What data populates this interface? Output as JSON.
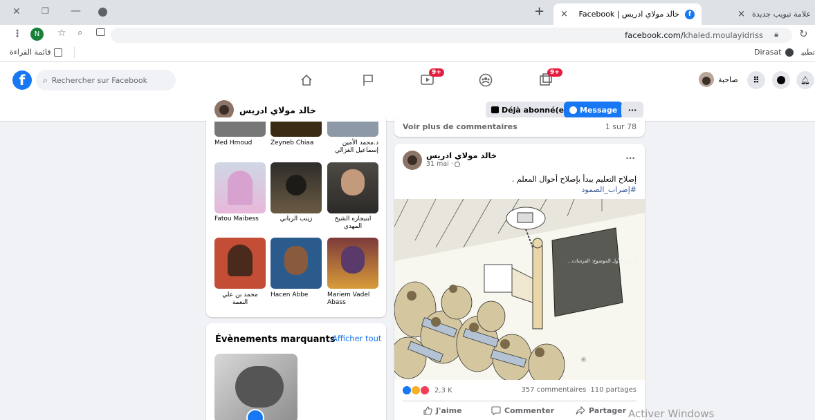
{
  "browser": {
    "tabs": [
      {
        "label": "خالد مولاي ادريس | Facebook",
        "close": "×"
      },
      {
        "label": "علامة تبويب جديدة",
        "close": "×"
      }
    ],
    "new_tab": "+",
    "url_host": "facebook.com/",
    "url_path": "khaled.moulayidriss",
    "profile_initial": "N",
    "bookmarks": {
      "reading_list": "قائمة القراءة",
      "dirasat": "Dirasat",
      "apps": "تطبيقات"
    }
  },
  "facebook": {
    "search_placeholder": "Rechercher sur Facebook",
    "video_badge": "9+",
    "notif_badge": "9+",
    "user_name": "صاحبة",
    "profile": {
      "name": "خالد مولاي ادريس",
      "subscribed": "Déjà abonné(e)",
      "message": "Message",
      "more": "···"
    },
    "friends": [
      {
        "name": "Med Hmoud"
      },
      {
        "name": "Zeyneb Chiaa"
      },
      {
        "name": "د.محمد الأمين إسماعيل الغزالي"
      },
      {
        "name": "Fatou Maibess"
      },
      {
        "name": "زينب الرباني"
      },
      {
        "name": "ابنيجاره الشيخ المهدي"
      },
      {
        "name": "محمد بن علي النعمة"
      },
      {
        "name": "Hacen Abbe"
      },
      {
        "name": "Mariem Vadel Abass"
      }
    ],
    "highlights": {
      "title": "Évènements marquants",
      "see_all": "Afficher tout"
    },
    "prev_post": {
      "more_comments": "Voir plus de commentaires",
      "count": "1 sur 78"
    },
    "post": {
      "author": "خالد مولاي ادريس",
      "date": "31 mai · ",
      "more": "···",
      "text": "إصلاح التعليم يبدأ بإصلاح أحوال المعلم .",
      "hashtag": "#إضراب_الصمود",
      "board_text": "...الدرس الأول الموضوع: الفرشات",
      "reactions": "2,3 K",
      "comments": "357 commentaires",
      "shares": "110 partages",
      "like": "J'aime",
      "comment": "Commenter",
      "share": "Partager"
    },
    "watermark": "Activer Windows"
  },
  "colors": {
    "fb_blue": "#1877f2",
    "badge_red": "#e41e3f",
    "muted": "#65676b"
  }
}
